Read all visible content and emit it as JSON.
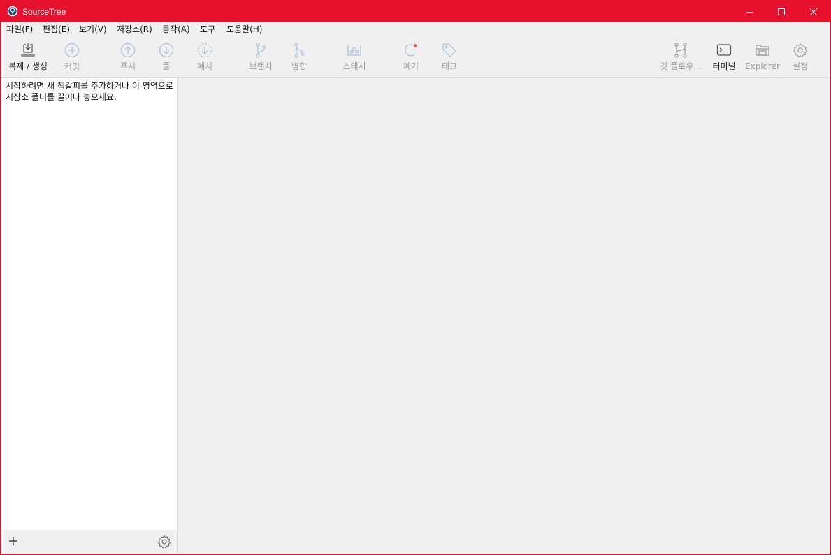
{
  "window": {
    "title": "SourceTree"
  },
  "menu": [
    {
      "label": "파일(F)"
    },
    {
      "label": "편집(E)"
    },
    {
      "label": "보기(V)"
    },
    {
      "label": "저장소(R)"
    },
    {
      "label": "동작(A)"
    },
    {
      "label": "도구"
    },
    {
      "label": "도움말(H)"
    }
  ],
  "toolbar": {
    "clone": {
      "label": "복제 / 생성",
      "icon": "clone-download-icon"
    },
    "commit": {
      "label": "커밋",
      "icon": "plus-circle-icon"
    },
    "push": {
      "label": "푸시",
      "icon": "arrow-up-circle-icon"
    },
    "pull": {
      "label": "풀",
      "icon": "arrow-down-circle-icon"
    },
    "fetch": {
      "label": "페치",
      "icon": "arrow-down-dashed-circle-icon"
    },
    "branch": {
      "label": "브랜치",
      "icon": "branch-icon"
    },
    "merge": {
      "label": "병합",
      "icon": "merge-icon"
    },
    "stash": {
      "label": "스태시",
      "icon": "stash-icon"
    },
    "discard": {
      "label": "폐기",
      "icon": "discard-icon"
    },
    "tag": {
      "label": "태그",
      "icon": "tag-icon"
    },
    "gitflow": {
      "label": "깃 플로우...",
      "icon": "git-flow-icon"
    },
    "terminal": {
      "label": "터미널",
      "icon": "terminal-icon"
    },
    "explorer": {
      "label": "Explorer",
      "icon": "folder-icon"
    },
    "settings": {
      "label": "설정",
      "icon": "gear-icon"
    }
  },
  "sidebar": {
    "hint": "시작하려면 새 책갈피를 추가하거나 이 영역으로 저장소 폴더를 끌어다 놓으세요."
  },
  "colors": {
    "titlebar": "#e8112d",
    "icon_enabled": "#555555",
    "icon_disabled": "#a8c0dc"
  }
}
